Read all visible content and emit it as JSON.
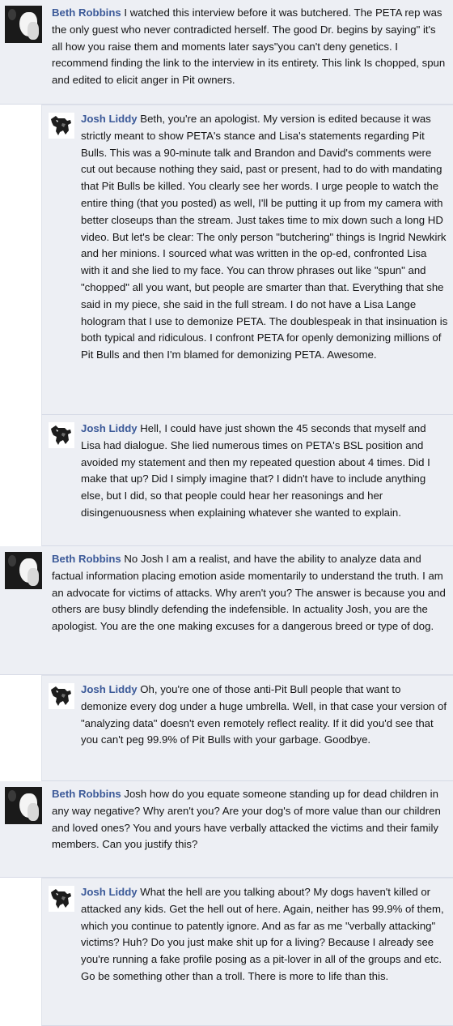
{
  "comments": [
    {
      "author": "Beth Robbins",
      "text": " I watched this interview before it was butchered. The PETA rep was the only guest who never contradicted herself. The good Dr. begins by saying\" it's all how you raise them and moments later says\"you can't deny genetics. I recommend finding the link to the interview in its entirety. This link Is chopped, spun and edited to elicit anger in Pit owners.",
      "replies": [
        {
          "author": "Josh Liddy",
          "text": " Beth, you're an apologist. My version is edited because it was strictly meant to show PETA's stance and Lisa's statements regarding Pit Bulls. This was a 90-minute talk and Brandon and David's comments were cut out because nothing they said, past or present, had to do with mandating that Pit Bulls be killed. You clearly see her words. I urge people to watch the entire thing (that you posted) as well, I'll be putting it up from my camera with better closeups than the stream. Just takes time to mix down such a long HD video. But let's be clear: The only person \"butchering\" things is Ingrid Newkirk and her minions. I sourced what was written in the op-ed, confronted Lisa with it and she lied to my face. You can throw phrases out like \"spun\" and \"chopped\" all you want, but people are smarter than that. Everything that she said in my piece, she said in the full stream. I do not have a Lisa Lange hologram that I use to demonize PETA. The doublespeak in that insinuation is both typical and ridiculous. I confront PETA for openly demonizing millions of Pit Bulls and then I'm blamed for demonizing PETA. Awesome."
        },
        {
          "author": "Josh Liddy",
          "text": " Hell, I could have just shown the 45 seconds that myself and Lisa had dialogue. She lied numerous times on PETA's BSL position and avoided my statement and then my repeated question about 4 times. Did I make that up? Did I simply imagine that? I didn't have to include anything else, but I did, so that people could hear her reasonings and her disingenuousness when explaining whatever she wanted to explain."
        }
      ]
    },
    {
      "author": "Beth Robbins",
      "text": " No Josh I am a realist, and have the ability to analyze data and factual information placing emotion aside momentarily to understand the truth. I am an advocate for victims of attacks. Why aren't you? The answer is because you and others are busy blindly defending the indefensible. In actuality Josh, you are the apologist. You are the one making excuses for a dangerous breed or type of dog.",
      "replies": [
        {
          "author": "Josh Liddy",
          "text": " Oh, you're one of those anti-Pit Bull people that want to demonize every dog under a huge umbrella. Well, in that case your version of \"analyzing data\" doesn't even remotely reflect reality. If it did you'd see that you can't peg 99.9% of Pit Bulls with your garbage. Goodbye."
        }
      ]
    },
    {
      "author": "Beth Robbins",
      "text": " Josh how do you equate someone standing up for dead children in any way negative? Why aren't you? Are your dog's of more value than our children and loved ones? You and yours have verbally attacked the victims and their family members. Can you justify this?",
      "replies": [
        {
          "author": "Josh Liddy",
          "text": " What the hell are you talking about? My dogs haven't killed or attacked any kids. Get the hell out of here. Again, neither has 99.9% of them, which you continue to patently ignore. And as far as me \"verbally attacking\" victims? Huh? Do you just make shit up for a living? Because I already see you're running a fake profile posing as a pit-lover in all of the groups and etc. Go be something other than a troll. There is more to life than this."
        }
      ]
    }
  ],
  "colors": {
    "author_link": "#3b5998",
    "comment_bg": "#edeff4",
    "divider": "#d7dbe6"
  },
  "icons": {
    "beth_avatar": "profile-photo-bw",
    "josh_avatar": "dog-silhouette"
  }
}
